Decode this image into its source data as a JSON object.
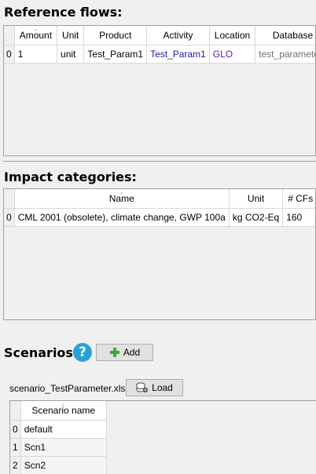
{
  "reference_flows": {
    "title": "Reference flows:",
    "columns": [
      "Amount",
      "Unit",
      "Product",
      "Activity",
      "Location",
      "Database"
    ],
    "rows": [
      {
        "index": "0",
        "amount": "1",
        "unit": "unit",
        "product": "Test_Param1",
        "activity": "Test_Param1",
        "location": "GLO",
        "database": "test_parameters"
      }
    ]
  },
  "impact_categories": {
    "title": "Impact categories:",
    "columns": [
      "Name",
      "Unit",
      "# CFs"
    ],
    "rows": [
      {
        "index": "0",
        "name": "CML 2001 (obsolete), climate change, GWP 100a",
        "unit": "kg CO2-Eq",
        "cfs": "160"
      }
    ]
  },
  "scenarios": {
    "title": "Scenarios:",
    "help_icon": "?",
    "add_label": "Add",
    "file_name": "scenario_TestParameter.xlsx",
    "load_label": "Load",
    "column": "Scenario name",
    "rows": [
      {
        "index": "0",
        "name": "default"
      },
      {
        "index": "1",
        "name": "Scn1"
      },
      {
        "index": "2",
        "name": "Scn2"
      }
    ]
  },
  "icons": {
    "add": "plus-icon",
    "load": "database-load-icon",
    "help": "help-icon"
  },
  "colors": {
    "help": "#2aa0d8",
    "add_plus": "#3aa83a",
    "activity_text": "#1a1aa6",
    "location_text": "#5a1aa6"
  }
}
